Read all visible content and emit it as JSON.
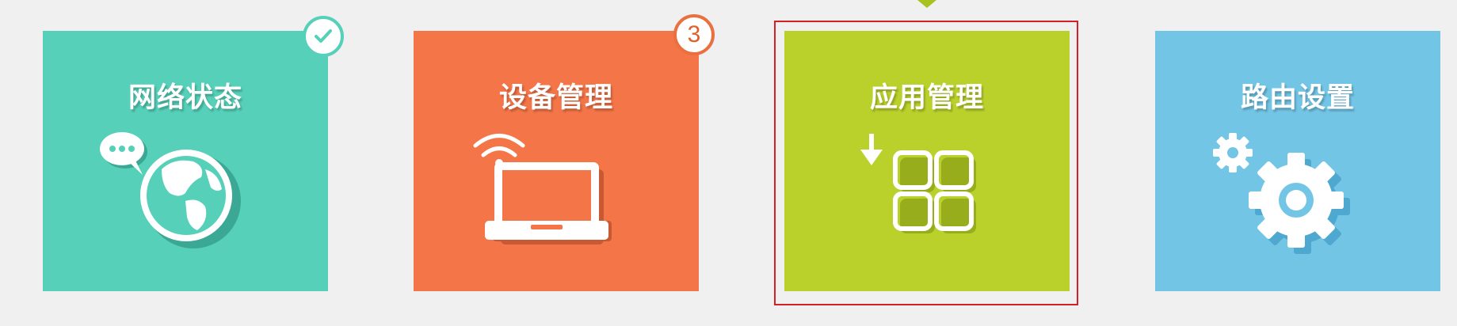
{
  "tiles": [
    {
      "id": "network",
      "label": "网络状态",
      "icon": "globe-icon",
      "color": "#56d0b9"
    },
    {
      "id": "devices",
      "label": "设备管理",
      "icon": "laptop-wifi-icon",
      "color": "#f47548"
    },
    {
      "id": "apps",
      "label": "应用管理",
      "icon": "app-grid-download-icon",
      "color": "#bad12c"
    },
    {
      "id": "router",
      "label": "路由设置",
      "icon": "gear-icon",
      "color": "#73c5e6"
    }
  ],
  "badges": {
    "network_status": "check-icon",
    "devices_count": "3"
  },
  "selected_tile": "apps",
  "colors": {
    "selection_border": "#d62026",
    "background": "#f0f0f0"
  }
}
